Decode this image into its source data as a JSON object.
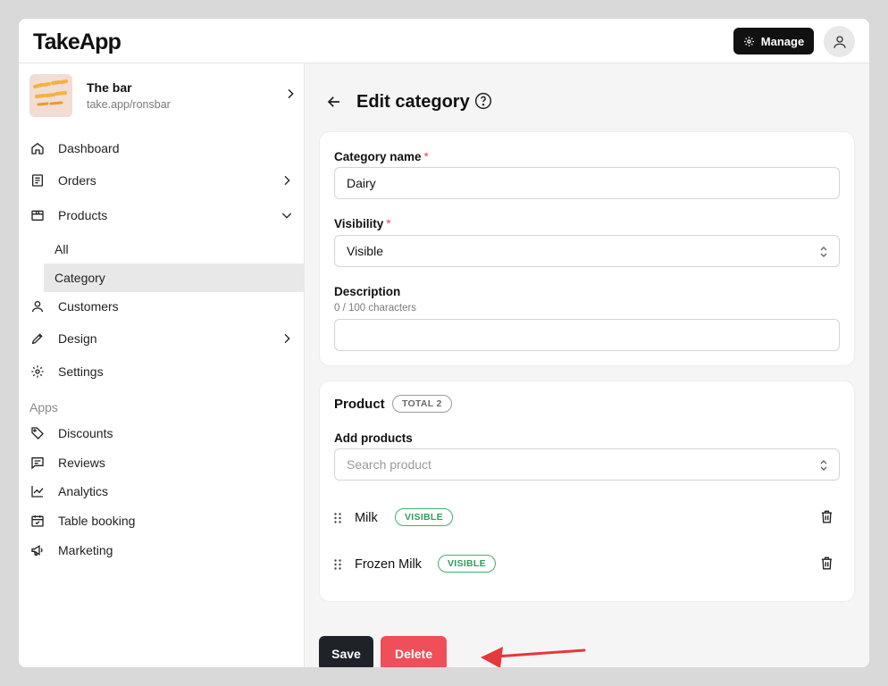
{
  "header": {
    "logo": "TakeApp",
    "manage_label": "Manage"
  },
  "store": {
    "name": "The bar",
    "url": "take.app/ronsbar"
  },
  "sidebar": {
    "items": [
      {
        "label": "Dashboard",
        "icon": "home-icon"
      },
      {
        "label": "Orders",
        "icon": "receipt-icon"
      },
      {
        "label": "Products",
        "icon": "box-icon"
      },
      {
        "label": "Customers",
        "icon": "user-icon"
      },
      {
        "label": "Design",
        "icon": "pen-icon"
      },
      {
        "label": "Settings",
        "icon": "gear-icon"
      }
    ],
    "products_sub": [
      {
        "label": "All"
      },
      {
        "label": "Category"
      }
    ],
    "apps_heading": "Apps",
    "apps": [
      {
        "label": "Discounts",
        "icon": "tag-icon"
      },
      {
        "label": "Reviews",
        "icon": "message-icon"
      },
      {
        "label": "Analytics",
        "icon": "chart-icon"
      },
      {
        "label": "Table booking",
        "icon": "calendar-icon"
      },
      {
        "label": "Marketing",
        "icon": "megaphone-icon"
      }
    ]
  },
  "page": {
    "title": "Edit category"
  },
  "form": {
    "category_name_label": "Category name",
    "category_name_value": "Dairy",
    "required_mark": "*",
    "visibility_label": "Visibility",
    "visibility_value": "Visible",
    "description_label": "Description",
    "description_hint": "0 / 100 characters",
    "description_value": ""
  },
  "products": {
    "title": "Product",
    "total_badge": "TOTAL 2",
    "add_label": "Add products",
    "search_placeholder": "Search product",
    "rows": [
      {
        "name": "Milk",
        "status": "VISIBLE"
      },
      {
        "name": "Frozen Milk",
        "status": "VISIBLE"
      }
    ]
  },
  "actions": {
    "save_label": "Save",
    "delete_label": "Delete"
  },
  "colors": {
    "accent_dark": "#111111",
    "delete_red": "#ef4f58",
    "visible_green": "#3fb36c",
    "arrow_red": "#e5383b"
  }
}
